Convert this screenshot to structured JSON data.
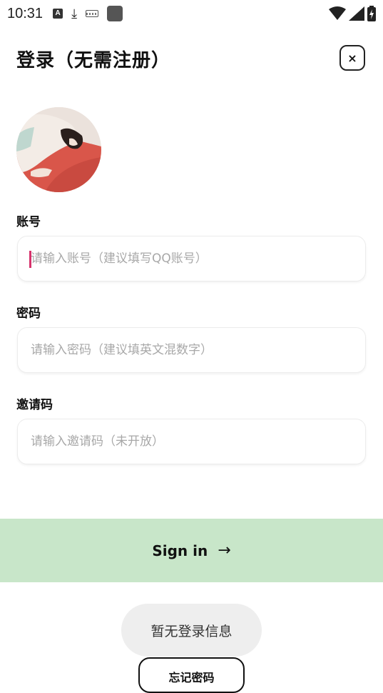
{
  "status_bar": {
    "time": "10:31",
    "icons": [
      "text-a-icon",
      "download-icon",
      "keyboard-icon",
      "app-square-icon",
      "wifi-icon",
      "cell-signal-icon",
      "battery-charging-icon"
    ]
  },
  "header": {
    "title": "登录（无需注册）",
    "close_label": "×"
  },
  "avatar": {
    "icon": "avatar-illustration"
  },
  "form": {
    "account": {
      "label": "账号",
      "placeholder": "请输入账号（建议填写QQ账号）",
      "value": ""
    },
    "password": {
      "label": "密码",
      "placeholder": "请输入密码（建议填英文混数字）",
      "value": ""
    },
    "invite": {
      "label": "邀请码",
      "placeholder": "请输入邀请码（未开放）",
      "value": ""
    }
  },
  "signin": {
    "label": "Sign in",
    "arrow": "→",
    "color": "#c8e6c9"
  },
  "toast": {
    "text": "暂无登录信息"
  },
  "forgot": {
    "label": "忘记密码"
  },
  "colors": {
    "cursor": "#d6336c",
    "primary_button_bg": "#c8e6c9"
  }
}
